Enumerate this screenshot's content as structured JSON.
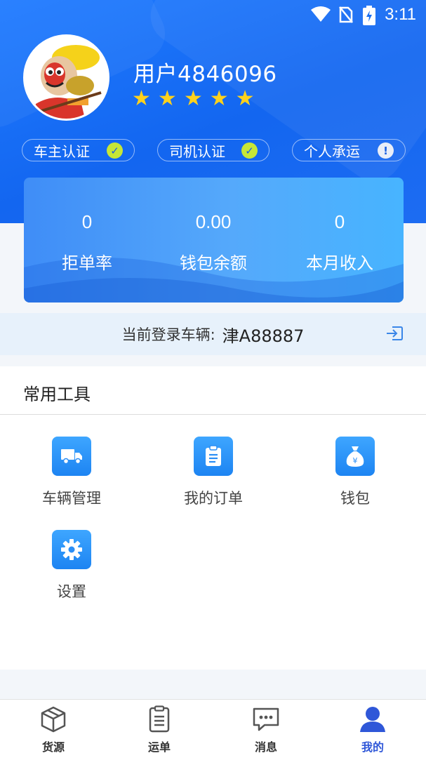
{
  "status_bar": {
    "time": "3:11"
  },
  "profile": {
    "username": "用户4846096",
    "rating_stars": 5,
    "stars": [
      "★",
      "★",
      "★",
      "★",
      "★"
    ]
  },
  "badges": [
    {
      "label": "车主认证",
      "status": "verified"
    },
    {
      "label": "司机认证",
      "status": "verified"
    },
    {
      "label": "个人承运",
      "status": "warning"
    }
  ],
  "badge_icons": {
    "verified": "✓",
    "warning": "!"
  },
  "stats": [
    {
      "value": "0",
      "label": "拒单率"
    },
    {
      "value": "0.00",
      "label": "钱包余额"
    },
    {
      "value": "0",
      "label": "本月收入"
    }
  ],
  "vehicle": {
    "label": "当前登录车辆:",
    "plate": "津A88887"
  },
  "tools": {
    "title": "常用工具",
    "items": [
      {
        "label": "车辆管理",
        "icon": "truck-icon"
      },
      {
        "label": "我的订单",
        "icon": "clipboard-icon"
      },
      {
        "label": "钱包",
        "icon": "money-bag-icon"
      },
      {
        "label": "设置",
        "icon": "gear-icon"
      }
    ]
  },
  "tabbar": {
    "items": [
      {
        "label": "货源",
        "icon": "box-icon"
      },
      {
        "label": "运单",
        "icon": "document-icon"
      },
      {
        "label": "消息",
        "icon": "chat-icon"
      },
      {
        "label": "我的",
        "icon": "user-icon"
      }
    ],
    "active_index": 3
  },
  "colors": {
    "header_blue": "#1366f0",
    "star_yellow": "#ffd21c",
    "verified_green": "#c6e637",
    "active_tab": "#2f57d8"
  }
}
